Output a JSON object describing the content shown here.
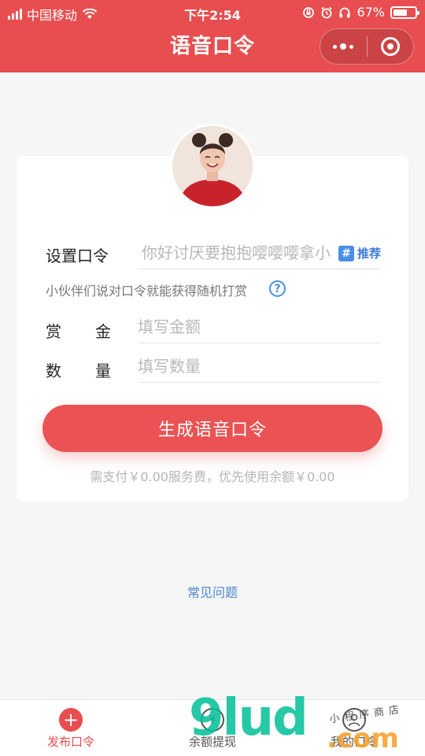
{
  "status_bar": {
    "carrier": "中国移动",
    "time": "下午2:54",
    "battery_percent": "67%",
    "battery_level": 0.67,
    "icons": [
      "signal-icon",
      "wifi-icon",
      "rotation-lock-icon",
      "alarm-icon",
      "headphones-icon",
      "battery-icon"
    ]
  },
  "nav": {
    "title": "语音口令",
    "capsule_icons": [
      "more-dots-icon",
      "close-target-icon"
    ]
  },
  "form": {
    "password_label": "设置口令",
    "password_placeholder": "你好讨厌要抱抱嘤嘤嘤拿小",
    "recommend_hash": "#",
    "recommend_label": "推荐",
    "hint": "小伙伴们说对口令就能获得随机打赏",
    "help_icon": "?",
    "reward_label": "赏金",
    "reward_placeholder": "填写金额",
    "quantity_label": "数量",
    "quantity_placeholder": "填写数量"
  },
  "generate_button": "生成语音口令",
  "fee_text": "需支付￥0.00服务费，优先使用余额￥0.00",
  "faq_link": "常见问题",
  "tabs": [
    {
      "label": "发布口令",
      "icon": "plus-icon",
      "active": true,
      "glyph": "+"
    },
    {
      "label": "余额提现",
      "icon": "yen-icon",
      "active": false,
      "glyph": "¥"
    },
    {
      "label": "我的口令",
      "icon": "user-icon",
      "active": false,
      "glyph": ""
    }
  ],
  "watermark": {
    "brand": "9lud",
    "suffix": ".com",
    "small": "小程序商店"
  },
  "colors": {
    "accent": "#e84d4f",
    "link": "#4a85cf",
    "background": "#f6f6f6"
  }
}
